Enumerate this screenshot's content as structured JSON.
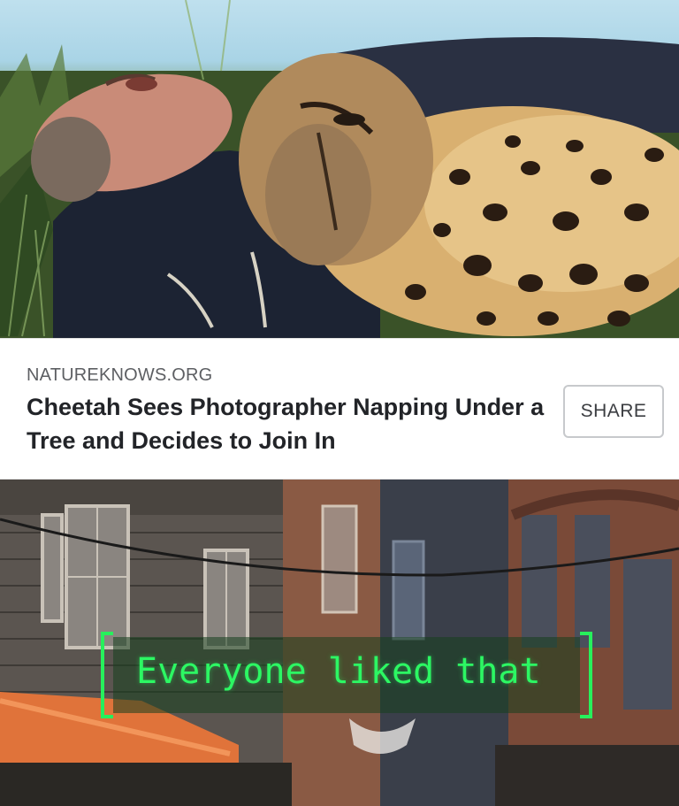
{
  "link_card": {
    "source": "NATUREKNOWS.ORG",
    "title": "Cheetah Sees Photographer Napping Under a Tree and Decides to Join In",
    "share_label": "SHARE"
  },
  "game_overlay": {
    "caption": "Everyone liked that",
    "caption_color": "#2cf763"
  },
  "colors": {
    "card_background": "#ffffff",
    "title_text": "#222428",
    "source_text": "#5d5f63",
    "button_border": "#c7c9cc"
  }
}
